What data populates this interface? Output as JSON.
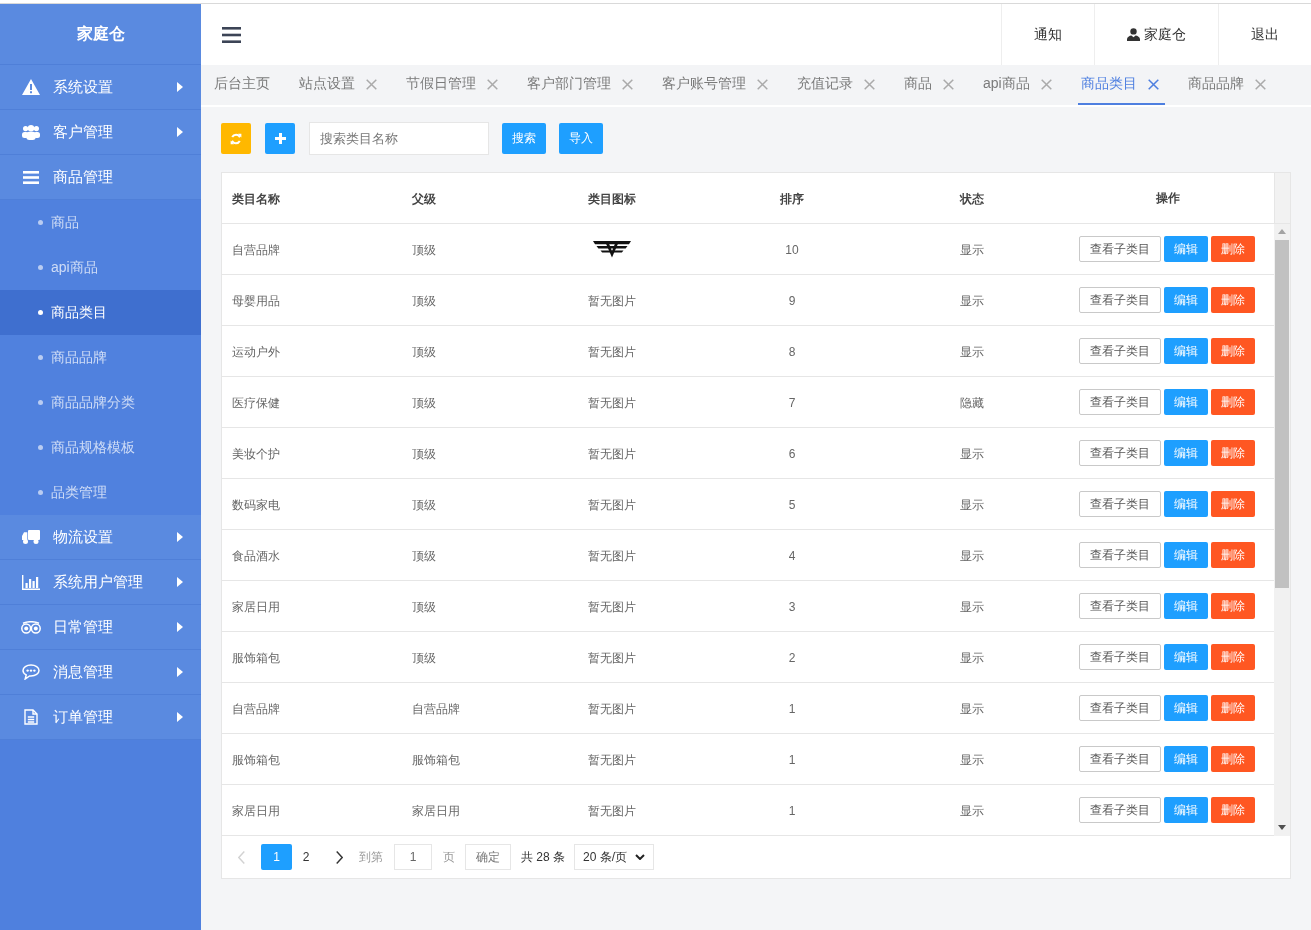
{
  "sidebar": {
    "title": "家庭仓",
    "items": [
      {
        "label": "系统设置",
        "expanded": false
      },
      {
        "label": "客户管理",
        "expanded": false
      },
      {
        "label": "商品管理",
        "expanded": true,
        "children": [
          {
            "label": "商品",
            "selected": false
          },
          {
            "label": "api商品",
            "selected": false
          },
          {
            "label": "商品类目",
            "selected": true
          },
          {
            "label": "商品品牌",
            "selected": false
          },
          {
            "label": "商品品牌分类",
            "selected": false
          },
          {
            "label": "商品规格模板",
            "selected": false
          },
          {
            "label": "品类管理",
            "selected": false
          }
        ]
      },
      {
        "label": "物流设置",
        "expanded": false
      },
      {
        "label": "系统用户管理",
        "expanded": false
      },
      {
        "label": "日常管理",
        "expanded": false
      },
      {
        "label": "消息管理",
        "expanded": false
      },
      {
        "label": "订单管理",
        "expanded": false
      }
    ]
  },
  "header": {
    "links": [
      {
        "label": "通知",
        "kind": "text"
      },
      {
        "label": "家庭仓",
        "kind": "user"
      },
      {
        "label": "退出",
        "kind": "text"
      }
    ]
  },
  "tabs": [
    {
      "label": "后台主页",
      "closable": false,
      "selected": false
    },
    {
      "label": "站点设置",
      "closable": true,
      "selected": false
    },
    {
      "label": "节假日管理",
      "closable": true,
      "selected": false
    },
    {
      "label": "客户部门管理",
      "closable": true,
      "selected": false
    },
    {
      "label": "客户账号管理",
      "closable": true,
      "selected": false
    },
    {
      "label": "充值记录",
      "closable": true,
      "selected": false
    },
    {
      "label": "商品",
      "closable": true,
      "selected": false
    },
    {
      "label": "api商品",
      "closable": true,
      "selected": false
    },
    {
      "label": "商品类目",
      "closable": true,
      "selected": true
    },
    {
      "label": "商品品牌",
      "closable": true,
      "selected": false
    }
  ],
  "toolbar": {
    "search": {
      "placeholder": "搜索类目名称"
    },
    "buttons": [
      {
        "label": "搜索"
      },
      {
        "label": "导入"
      }
    ]
  },
  "table": {
    "columns": [
      "类目名称",
      "父级",
      "类目图标",
      "排序",
      "状态",
      "操作"
    ],
    "rows": [
      {
        "name": "自营品牌",
        "parent": "顶级",
        "icon": {
          "kind": "image"
        },
        "sort": "10",
        "status": "显示",
        "actions": [
          {
            "label": "查看子类目",
            "kind": "default"
          },
          {
            "label": "编辑",
            "kind": "primary"
          },
          {
            "label": "删除",
            "kind": "danger"
          }
        ]
      },
      {
        "name": "母婴用品",
        "parent": "顶级",
        "icon": {
          "kind": "text",
          "text": "暂无图片"
        },
        "sort": "9",
        "status": "显示",
        "actions": [
          {
            "label": "查看子类目",
            "kind": "default"
          },
          {
            "label": "编辑",
            "kind": "primary"
          },
          {
            "label": "删除",
            "kind": "danger"
          }
        ]
      },
      {
        "name": "运动户外",
        "parent": "顶级",
        "icon": {
          "kind": "text",
          "text": "暂无图片"
        },
        "sort": "8",
        "status": "显示",
        "actions": [
          {
            "label": "查看子类目",
            "kind": "default"
          },
          {
            "label": "编辑",
            "kind": "primary"
          },
          {
            "label": "删除",
            "kind": "danger"
          }
        ]
      },
      {
        "name": "医疗保健",
        "parent": "顶级",
        "icon": {
          "kind": "text",
          "text": "暂无图片"
        },
        "sort": "7",
        "status": "隐藏",
        "actions": [
          {
            "label": "查看子类目",
            "kind": "default"
          },
          {
            "label": "编辑",
            "kind": "primary"
          },
          {
            "label": "删除",
            "kind": "danger"
          }
        ]
      },
      {
        "name": "美妆个护",
        "parent": "顶级",
        "icon": {
          "kind": "text",
          "text": "暂无图片"
        },
        "sort": "6",
        "status": "显示",
        "actions": [
          {
            "label": "查看子类目",
            "kind": "default"
          },
          {
            "label": "编辑",
            "kind": "primary"
          },
          {
            "label": "删除",
            "kind": "danger"
          }
        ]
      },
      {
        "name": "数码家电",
        "parent": "顶级",
        "icon": {
          "kind": "text",
          "text": "暂无图片"
        },
        "sort": "5",
        "status": "显示",
        "actions": [
          {
            "label": "查看子类目",
            "kind": "default"
          },
          {
            "label": "编辑",
            "kind": "primary"
          },
          {
            "label": "删除",
            "kind": "danger"
          }
        ]
      },
      {
        "name": "食品酒水",
        "parent": "顶级",
        "icon": {
          "kind": "text",
          "text": "暂无图片"
        },
        "sort": "4",
        "status": "显示",
        "actions": [
          {
            "label": "查看子类目",
            "kind": "default"
          },
          {
            "label": "编辑",
            "kind": "primary"
          },
          {
            "label": "删除",
            "kind": "danger"
          }
        ]
      },
      {
        "name": "家居日用",
        "parent": "顶级",
        "icon": {
          "kind": "text",
          "text": "暂无图片"
        },
        "sort": "3",
        "status": "显示",
        "actions": [
          {
            "label": "查看子类目",
            "kind": "default"
          },
          {
            "label": "编辑",
            "kind": "primary"
          },
          {
            "label": "删除",
            "kind": "danger"
          }
        ]
      },
      {
        "name": "服饰箱包",
        "parent": "顶级",
        "icon": {
          "kind": "text",
          "text": "暂无图片"
        },
        "sort": "2",
        "status": "显示",
        "actions": [
          {
            "label": "查看子类目",
            "kind": "default"
          },
          {
            "label": "编辑",
            "kind": "primary"
          },
          {
            "label": "删除",
            "kind": "danger"
          }
        ]
      },
      {
        "name": "自营品牌",
        "parent": "自营品牌",
        "icon": {
          "kind": "text",
          "text": "暂无图片"
        },
        "sort": "1",
        "status": "显示",
        "actions": [
          {
            "label": "查看子类目",
            "kind": "default"
          },
          {
            "label": "编辑",
            "kind": "primary"
          },
          {
            "label": "删除",
            "kind": "danger"
          }
        ]
      },
      {
        "name": "服饰箱包",
        "parent": "服饰箱包",
        "icon": {
          "kind": "text",
          "text": "暂无图片"
        },
        "sort": "1",
        "status": "显示",
        "actions": [
          {
            "label": "查看子类目",
            "kind": "default"
          },
          {
            "label": "编辑",
            "kind": "primary"
          },
          {
            "label": "删除",
            "kind": "danger"
          }
        ]
      },
      {
        "name": "家居日用",
        "parent": "家居日用",
        "icon": {
          "kind": "text",
          "text": "暂无图片"
        },
        "sort": "1",
        "status": "显示",
        "actions": [
          {
            "label": "查看子类目",
            "kind": "default"
          },
          {
            "label": "编辑",
            "kind": "primary"
          },
          {
            "label": "删除",
            "kind": "danger"
          }
        ]
      }
    ]
  },
  "pagination": {
    "prev_disabled": true,
    "next_disabled": false,
    "pages": [
      {
        "label": "1",
        "selected": true
      },
      {
        "label": "2",
        "selected": false
      }
    ],
    "goto_label": "到第",
    "goto_value": "1",
    "page_label": "页",
    "confirm": "确定",
    "total": "共 28 条",
    "page_size": "20 条/页"
  }
}
